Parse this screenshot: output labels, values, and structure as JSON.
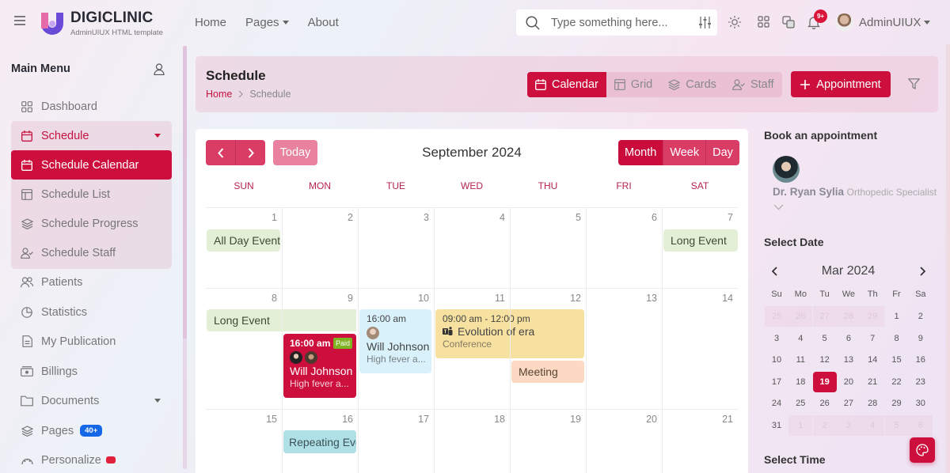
{
  "header": {
    "brand": "DIGICLINIC",
    "brand_sub": "AdminUIUX HTML template",
    "nav": [
      "Home",
      "Pages",
      "About"
    ],
    "search_placeholder": "Type something here...",
    "notification_count": "9+",
    "user_name": "AdminUIUX"
  },
  "sidebar": {
    "title": "Main Menu",
    "items": [
      {
        "label": "Dashboard",
        "icon": "grid-icon"
      },
      {
        "label": "Schedule",
        "icon": "calendar-icon"
      },
      {
        "label": "Schedule Calendar",
        "icon": "calendar-icon"
      },
      {
        "label": "Schedule List",
        "icon": "table-icon"
      },
      {
        "label": "Schedule Progress",
        "icon": "layers-icon"
      },
      {
        "label": "Schedule Staff",
        "icon": "user-check-icon"
      },
      {
        "label": "Patients",
        "icon": "users-icon"
      },
      {
        "label": "Statistics",
        "icon": "pie-chart-icon"
      },
      {
        "label": "My Publication",
        "icon": "document-icon"
      },
      {
        "label": "Billings",
        "icon": "cash-icon"
      },
      {
        "label": "Documents",
        "icon": "folder-icon"
      },
      {
        "label": "Pages",
        "icon": "layers-icon",
        "badge": "40+"
      },
      {
        "label": "Personalize",
        "icon": "palette-icon"
      }
    ]
  },
  "page": {
    "title": "Schedule",
    "breadcrumb": [
      "Home",
      "Schedule"
    ],
    "view_tabs": [
      "Calendar",
      "Grid",
      "Cards",
      "Staff"
    ],
    "active_view": "Calendar",
    "add_button": "Appointment"
  },
  "calendar": {
    "today_label": "Today",
    "title": "September 2024",
    "view_buttons": [
      "Month",
      "Week",
      "Day"
    ],
    "active_view_button": "Month",
    "weekdays": [
      "SUN",
      "MON",
      "TUE",
      "WED",
      "THU",
      "FRI",
      "SAT"
    ],
    "weeks": [
      [
        "1",
        "2",
        "3",
        "4",
        "5",
        "6",
        "7"
      ],
      [
        "8",
        "9",
        "10",
        "11",
        "12",
        "13",
        "14"
      ],
      [
        "15",
        "16",
        "17",
        "18",
        "19",
        "20",
        "21"
      ]
    ],
    "events": {
      "all_day": "All Day Event",
      "long_event_1": "Long Event",
      "long_event_2": "Long Event",
      "appt_red": {
        "time": "16:00 am",
        "badge": "Paid",
        "name": "Will Johnson",
        "desc": "High fever a..."
      },
      "appt_blue": {
        "time": "16:00 am",
        "name": "Will Johnson",
        "desc": "High fever a..."
      },
      "conference": {
        "time": "09:00 am - 12:00 pm",
        "title": "Evolution of era",
        "type": "Conference"
      },
      "meeting": "Meeting",
      "repeating": "Repeating Event"
    }
  },
  "booking": {
    "title": "Book an appointment",
    "doctor_name": "Dr. Ryan Sylia",
    "doctor_specialty": "Orthopedic Specialist",
    "select_date_label": "Select Date",
    "mini_calendar": {
      "title": "Mar 2024",
      "weekdays": [
        "Su",
        "Mo",
        "Tu",
        "We",
        "Th",
        "Fr",
        "Sa"
      ],
      "weeks": [
        [
          "25",
          "26",
          "27",
          "28",
          "29",
          "1",
          "2"
        ],
        [
          "3",
          "4",
          "5",
          "6",
          "7",
          "8",
          "9"
        ],
        [
          "10",
          "11",
          "12",
          "13",
          "14",
          "15",
          "16"
        ],
        [
          "17",
          "18",
          "19",
          "20",
          "21",
          "22",
          "23"
        ],
        [
          "24",
          "25",
          "26",
          "27",
          "28",
          "29",
          "30"
        ],
        [
          "31",
          "1",
          "2",
          "3",
          "4",
          "5",
          "6"
        ]
      ],
      "selected": "19"
    },
    "select_time_label": "Select Time"
  },
  "colors": {
    "accent": "#cc0f3d",
    "badge_blue": "#1467e6",
    "paid_green": "#7fb321"
  }
}
